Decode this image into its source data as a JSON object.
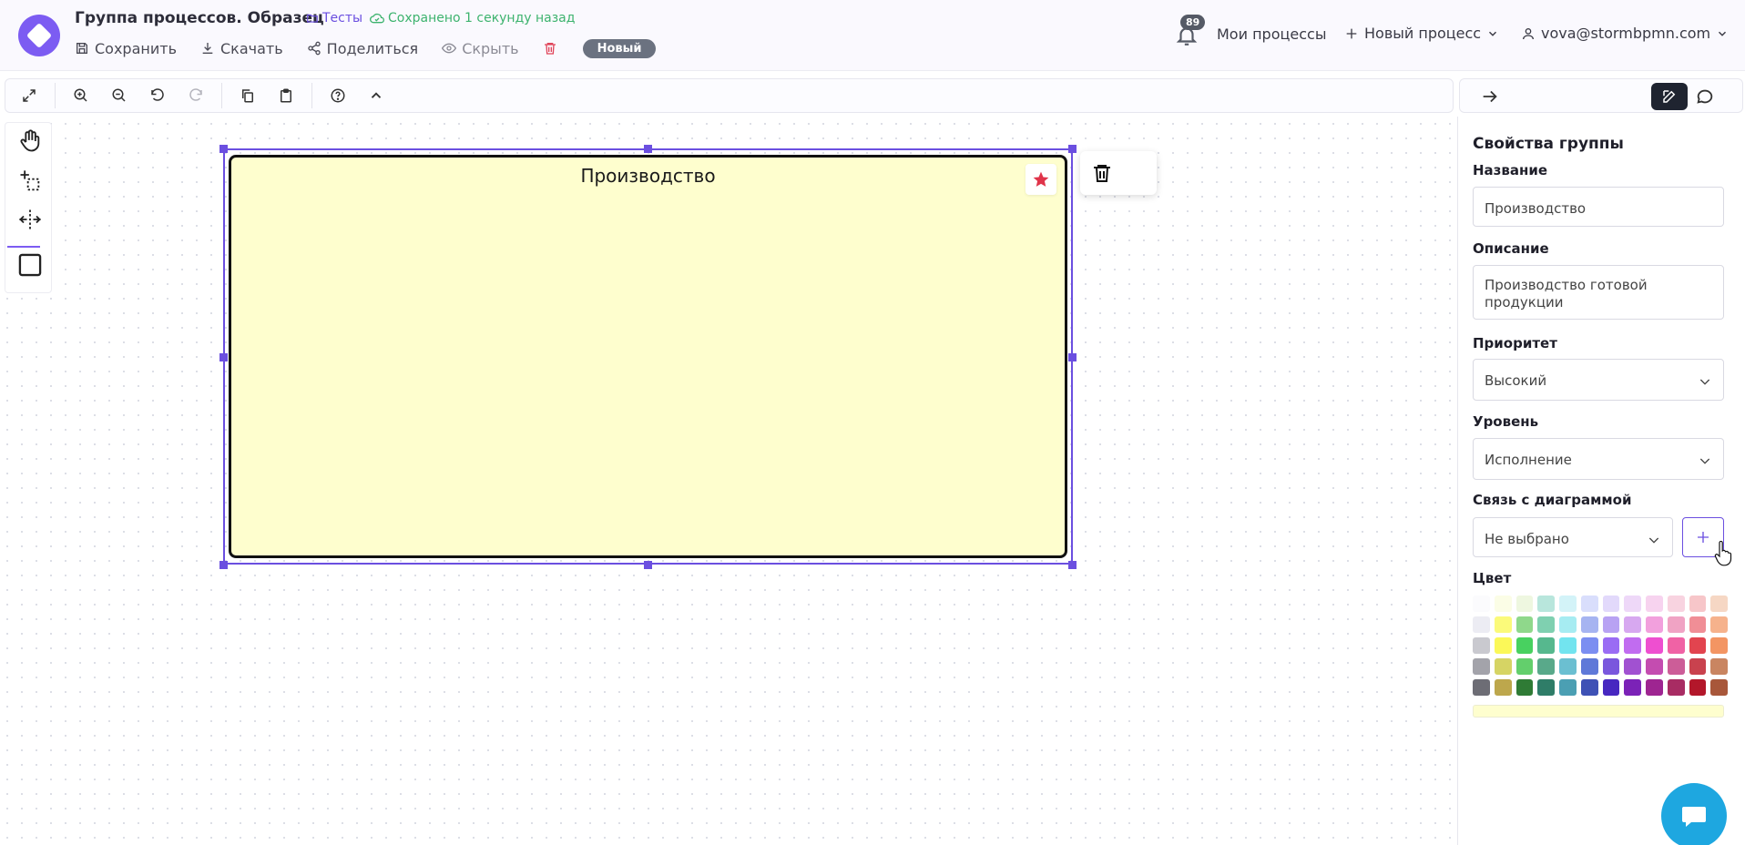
{
  "header": {
    "title": "Группа процессов. Образец",
    "folder": "Тесты",
    "saved_status": "Сохранено 1 секунду назад",
    "actions": {
      "save": "Сохранить",
      "download": "Скачать",
      "share": "Поделиться",
      "hide": "Скрыть"
    },
    "status_badge": "Новый",
    "notifications_count": "89",
    "my_processes": "Мои процессы",
    "new_process": "Новый процесс",
    "user_email": "vova@stormbpmn.com"
  },
  "canvas": {
    "group_name": "Производство"
  },
  "panel": {
    "title": "Свойства группы",
    "name_label": "Название",
    "name_value": "Производство",
    "description_label": "Описание",
    "description_value": "Производство готовой продукции",
    "priority_label": "Приоритет",
    "priority_value": "Высокий",
    "level_label": "Уровень",
    "level_value": "Исполнение",
    "diagram_link_label": "Связь с диаграммой",
    "diagram_link_value": "Не выбрано",
    "color_label": "Цвет",
    "selected_color": "#fefece",
    "palette": [
      [
        "#fbfbfd",
        "#fbfde6",
        "#eef7e0",
        "#b8e6dc",
        "#d3f3f8",
        "#d9defc",
        "#e2d9fb",
        "#eed8f8",
        "#f7d3ef",
        "#f8d3e0",
        "#f7c6c9",
        "#f6d7c4"
      ],
      [
        "#ececf3",
        "#fbfa7a",
        "#8fd88b",
        "#7fd0b0",
        "#a6ecf2",
        "#a6b4f1",
        "#b8a2f3",
        "#d7a8f0",
        "#f2a0dd",
        "#f0a3c4",
        "#f08e96",
        "#f6b28c"
      ],
      [
        "#c9c9cf",
        "#fbf858",
        "#48d160",
        "#56b88e",
        "#72e4ef",
        "#7b8ef1",
        "#9a6cf4",
        "#c16cf0",
        "#ee4fd0",
        "#f062a5",
        "#e2444f",
        "#f39563"
      ],
      [
        "#a3a3aa",
        "#d6d464",
        "#63cf6c",
        "#59a98a",
        "#6bbfd1",
        "#5f79d8",
        "#7a57dd",
        "#a151d1",
        "#c44cb0",
        "#cc5d98",
        "#c9424e",
        "#c98561"
      ],
      [
        "#6d6d75",
        "#bda74c",
        "#2f7b35",
        "#2f7d68",
        "#4b9fb3",
        "#3e51b5",
        "#4727c0",
        "#7b22b7",
        "#9e2591",
        "#a82c63",
        "#b3172a",
        "#a8573a"
      ]
    ]
  }
}
